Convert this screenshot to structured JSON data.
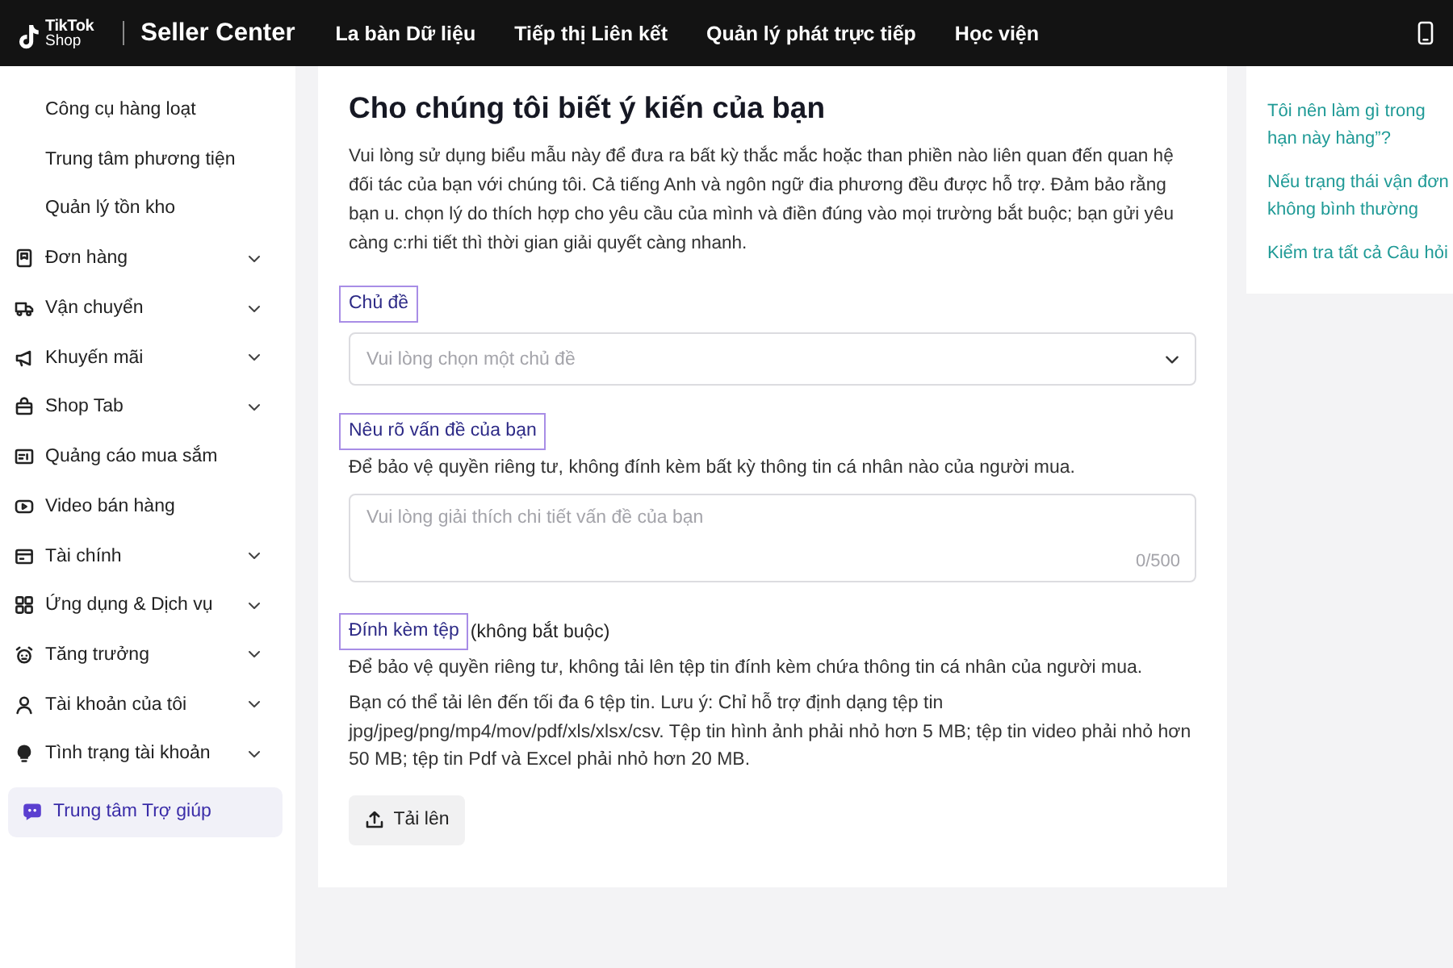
{
  "top_bar": {
    "logo": {
      "line_1": "TikTok",
      "line_2": "Shop"
    },
    "title": "Seller Center",
    "nav": [
      {
        "label": "La bàn Dữ liệu"
      },
      {
        "label": "Tiếp thị Liên kết"
      },
      {
        "label": "Quản lý phát trực tiếp"
      },
      {
        "label": "Học viện"
      }
    ]
  },
  "sidebar": {
    "sub_items": [
      {
        "label": "Công cụ hàng loạt"
      },
      {
        "label": "Trung tâm phương tiện"
      },
      {
        "label": "Quản lý tồn kho"
      }
    ],
    "items": [
      {
        "label": "Đơn hàng",
        "kind": "group",
        "selected": false
      },
      {
        "label": "Vận chuyển",
        "kind": "group",
        "selected": false
      },
      {
        "label": "Khuyến mãi",
        "kind": "group",
        "selected": false
      },
      {
        "label": "Shop Tab",
        "kind": "group",
        "selected": false
      },
      {
        "label": "Quảng cáo mua sắm",
        "kind": "link",
        "selected": false
      },
      {
        "label": "Video bán hàng",
        "kind": "link",
        "selected": false
      },
      {
        "label": "Tài chính",
        "kind": "group",
        "selected": false
      },
      {
        "label": "Ứng dụng & Dịch vụ",
        "kind": "group",
        "selected": false
      },
      {
        "label": "Tăng trưởng",
        "kind": "group",
        "selected": false
      },
      {
        "label": "Tài khoản của tôi",
        "kind": "group",
        "selected": false
      },
      {
        "label": "Tình trạng tài khoản",
        "kind": "group",
        "selected": false
      },
      {
        "label": "Trung tâm Trợ giúp",
        "kind": "link",
        "selected": true
      }
    ]
  },
  "form": {
    "title": "Cho chúng tôi biết ý kiến của bạn",
    "intro": "Vui lòng sử dụng biểu mẫu này để đưa ra bất kỳ thắc mắc hoặc than phiền nào liên quan đến quan hệ đối tác của bạn với chúng tôi. Cả tiếng Anh và ngôn ngữ đia phương đều được hỗ trợ. Đảm bảo rằng bạn u. chọn lý do thích hợp cho yêu cầu của mình và điền đúng vào mọi trường bắt buộc; bạn gửi yêu càng c:rhi tiết thì thời gian giải quyết càng nhanh.",
    "sections": [
      {
        "label": "Chủ đề",
        "highlighted": true,
        "kind": "select",
        "placeholder": "Vui lòng chọn một chủ đề"
      },
      {
        "label": "Nêu rõ vấn đề của bạn",
        "highlighted": true,
        "kind": "textarea",
        "hint": "Để bảo vệ quyền riêng tư, không đính kèm bất kỳ thông tin cá nhân nào của người mua.",
        "placeholder": "Vui lòng giải thích chi tiết vấn đề của bạn",
        "counter": "0/500"
      },
      {
        "label": "Đính kèm tệp",
        "highlighted": true,
        "kind": "upload",
        "suffix": "(không bắt buộc)",
        "hint": "Để bảo vệ quyền riêng tư, không tải lên tệp tin đính kèm chứa thông tin cá nhân của người mua.",
        "note": "Bạn có thể tải lên đến tối đa 6 tệp tin. Lưu ý: Chỉ hỗ trợ định dạng tệp tin jpg/jpeg/png/mp4/mov/pdf/xls/xlsx/csv. Tệp tin hình ảnh phải nhỏ hơn 5 MB; tệp tin video phải nhỏ hơn 50 MB; tệp tin Pdf và Excel phải nhỏ hơn 20 MB.",
        "button": "Tải lên"
      }
    ]
  },
  "help_links": [
    {
      "label": "Tôi nên làm gì trong hạn này hàng”?"
    },
    {
      "label": "Nếu trạng thái vận đơn không bình thường"
    },
    {
      "label": "Kiểm tra tất cả Câu hỏi"
    }
  ]
}
